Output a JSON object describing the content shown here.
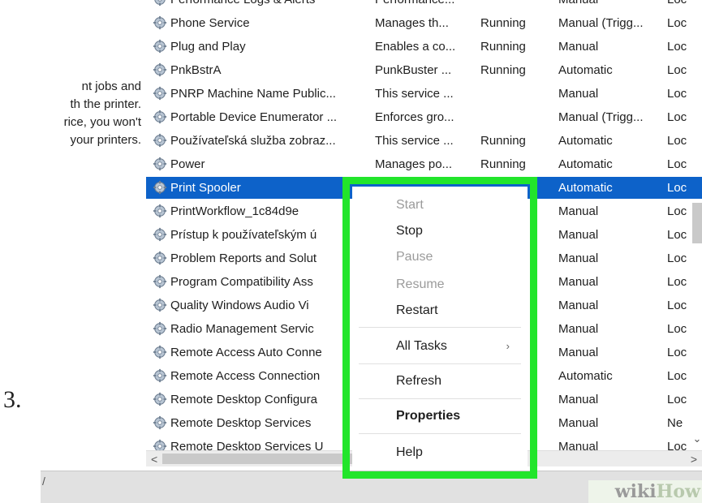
{
  "step_number": "3.",
  "description_text": [
    "nt jobs and",
    "th the printer.",
    "rice, you won't",
    "your printers."
  ],
  "services": [
    {
      "name": "Performance Logs & Alerts",
      "description": "Performance...",
      "status": "",
      "startup": "Manual",
      "logon": "Loc"
    },
    {
      "name": "Phone Service",
      "description": "Manages th...",
      "status": "Running",
      "startup": "Manual (Trigg...",
      "logon": "Loc"
    },
    {
      "name": "Plug and Play",
      "description": "Enables a co...",
      "status": "Running",
      "startup": "Manual",
      "logon": "Loc"
    },
    {
      "name": "PnkBstrA",
      "description": "PunkBuster ...",
      "status": "Running",
      "startup": "Automatic",
      "logon": "Loc"
    },
    {
      "name": "PNRP Machine Name Public...",
      "description": "This service ...",
      "status": "",
      "startup": "Manual",
      "logon": "Loc"
    },
    {
      "name": "Portable Device Enumerator ...",
      "description": "Enforces gro...",
      "status": "",
      "startup": "Manual (Trigg...",
      "logon": "Loc"
    },
    {
      "name": "Používateľská služba zobraz...",
      "description": "This service ...",
      "status": "Running",
      "startup": "Automatic",
      "logon": "Loc"
    },
    {
      "name": "Power",
      "description": "Manages po...",
      "status": "Running",
      "startup": "Automatic",
      "logon": "Loc"
    },
    {
      "name": "Print Spooler",
      "description": "",
      "status": "",
      "startup": "Automatic",
      "logon": "Loc",
      "selected": true
    },
    {
      "name": "PrintWorkflow_1c84d9e",
      "description": "",
      "status": "",
      "startup": "Manual",
      "logon": "Loc"
    },
    {
      "name": "Prístup k používateľským ú",
      "description": "",
      "status": "",
      "startup": "Manual",
      "logon": "Loc"
    },
    {
      "name": "Problem Reports and Solut",
      "description": "",
      "status": "",
      "startup": "Manual",
      "logon": "Loc"
    },
    {
      "name": "Program Compatibility Ass",
      "description": "",
      "status": "",
      "startup": "Manual",
      "logon": "Loc"
    },
    {
      "name": "Quality Windows Audio Vi",
      "description": "",
      "status": "",
      "startup": "Manual",
      "logon": "Loc"
    },
    {
      "name": "Radio Management Servic",
      "description": "",
      "status": "",
      "startup": "Manual",
      "logon": "Loc"
    },
    {
      "name": "Remote Access Auto Conne",
      "description": "",
      "status": "",
      "startup": "Manual",
      "logon": "Loc"
    },
    {
      "name": "Remote Access Connection",
      "description": "",
      "status": "",
      "startup": "Automatic",
      "logon": "Loc"
    },
    {
      "name": "Remote Desktop Configura",
      "description": "",
      "status": "",
      "startup": "Manual",
      "logon": "Loc"
    },
    {
      "name": "Remote Desktop Services",
      "description": "",
      "status": "",
      "startup": "Manual",
      "logon": "Ne"
    },
    {
      "name": "Remote Desktop Services U",
      "description": "",
      "status": "",
      "startup": "Manual",
      "logon": "Loc"
    }
  ],
  "context_menu": {
    "items": [
      {
        "label": "Start",
        "enabled": false
      },
      {
        "label": "Stop",
        "enabled": true
      },
      {
        "label": "Pause",
        "enabled": false
      },
      {
        "label": "Resume",
        "enabled": false
      },
      {
        "label": "Restart",
        "enabled": true
      },
      {
        "label": "All Tasks",
        "enabled": true,
        "submenu": true
      },
      {
        "label": "Refresh",
        "enabled": true
      },
      {
        "label": "Properties",
        "enabled": true,
        "bold": true
      },
      {
        "label": "Help",
        "enabled": true
      }
    ],
    "highlight_color": "#22e52b"
  },
  "scrollbar": {
    "left_arrow": "<",
    "right_arrow": ">",
    "down_arrow": "⌄"
  },
  "watermark": {
    "part1": "wiki",
    "part2": "How"
  },
  "colors": {
    "selection": "#0d62c9",
    "text": "#1e1e1e",
    "disabled": "#9b9b9b"
  }
}
